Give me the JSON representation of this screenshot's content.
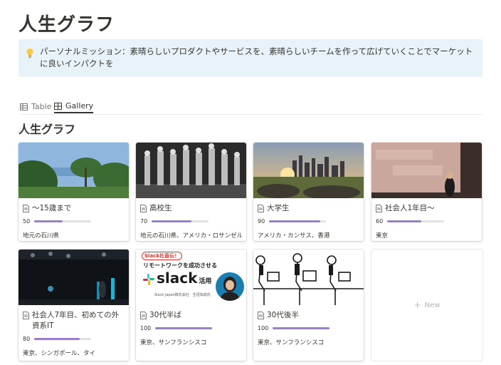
{
  "page": {
    "title": "人生グラフ"
  },
  "callout": {
    "icon": "lightbulb-icon",
    "text": "パーソナルミッション：素晴らしいプロダクトやサービスを、素晴らしいチームを作って広げていくことでマーケットに良いインパクトを"
  },
  "tabs": [
    {
      "label": "Table",
      "icon": "table-icon"
    },
    {
      "label": "Gallery",
      "icon": "gallery-icon"
    }
  ],
  "section": {
    "title": "人生グラフ"
  },
  "cards": [
    {
      "title": "〜15歳まで",
      "value": "50",
      "progress": 0.5,
      "place": "地元の石川県",
      "image": "coastal-trees-photo"
    },
    {
      "title": "高校生",
      "value": "70",
      "progress": 0.7,
      "place": "地元の石川県、アメリカ・ロサンゼルス",
      "image": "dance-performance-photo"
    },
    {
      "title": "大学生",
      "value": "90",
      "progress": 0.9,
      "place": "アメリカ・カンサス、香港",
      "image": "city-sunset-photo"
    },
    {
      "title": "社会人1年目〜",
      "value": "60",
      "progress": 0.6,
      "place": "東京",
      "image": "presentation-stage-photo"
    },
    {
      "title": "社会人7年目、初めての外資系IT",
      "value": "80",
      "progress": 0.8,
      "place": "東京、シンガポール、タイ",
      "image": "conference-stage-photo"
    },
    {
      "title": "30代半ば",
      "value": "100",
      "progress": 1.0,
      "place": "東京、サンフランシスコ",
      "image": "slack-banner",
      "banner": {
        "badge": "Slack社直伝！",
        "headline": "リモートワークを成功させる",
        "brand": "slack",
        "suffix": "活用",
        "footer": "Slack Japan株式会社　生垣佑成氏"
      }
    },
    {
      "title": "30代後半",
      "value": "100",
      "progress": 1.0,
      "place": "東京、サンフランシスコ",
      "image": "office-workers-illustration"
    }
  ],
  "new_card": {
    "label": "New"
  },
  "colors": {
    "callout_bg": "#e7f3f8",
    "progress_fill": "#9b7ecb",
    "text": "#37352f"
  }
}
